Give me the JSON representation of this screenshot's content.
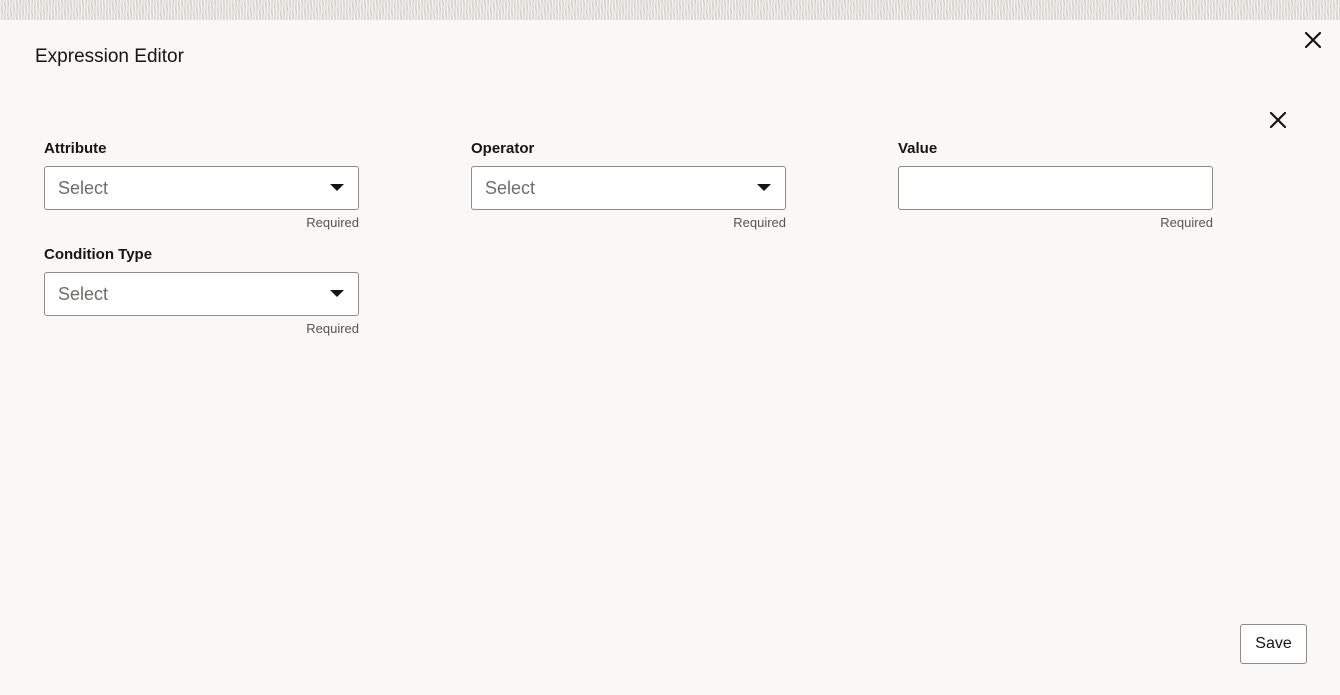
{
  "dialog": {
    "title": "Expression Editor",
    "close_icon": "close-icon"
  },
  "row": {
    "remove_icon": "close-icon"
  },
  "fields": {
    "attribute": {
      "label": "Attribute",
      "value": "Select",
      "helper": "Required"
    },
    "operator": {
      "label": "Operator",
      "value": "Select",
      "helper": "Required"
    },
    "value": {
      "label": "Value",
      "value": "",
      "helper": "Required"
    },
    "condition_type": {
      "label": "Condition Type",
      "value": "Select",
      "helper": "Required"
    }
  },
  "footer": {
    "save_label": "Save"
  }
}
